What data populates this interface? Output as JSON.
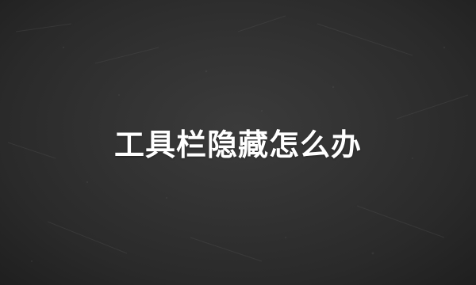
{
  "title": "工具栏隐藏怎么办",
  "colors": {
    "background": "#2f2f2f",
    "text": "#ffffff"
  }
}
